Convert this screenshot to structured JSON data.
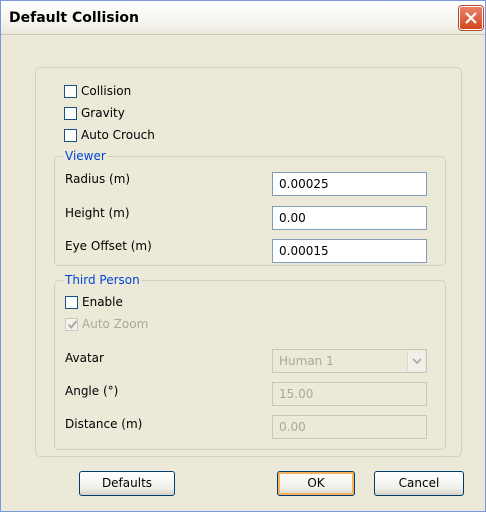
{
  "window": {
    "title": "Default Collision"
  },
  "checkboxes": {
    "collision": {
      "label": "Collision",
      "checked": false
    },
    "gravity": {
      "label": "Gravity",
      "checked": false
    },
    "auto_crouch": {
      "label": "Auto Crouch",
      "checked": false
    }
  },
  "viewer": {
    "legend": "Viewer",
    "radius": {
      "label": "Radius (m)",
      "value": "0.00025"
    },
    "height": {
      "label": "Height (m)",
      "value": "0.00"
    },
    "eye_offset": {
      "label": "Eye Offset (m)",
      "value": "0.00015"
    }
  },
  "third_person": {
    "legend": "Third Person",
    "enable": {
      "label": "Enable",
      "checked": false
    },
    "auto_zoom": {
      "label": "Auto Zoom",
      "checked": true,
      "disabled": true
    },
    "avatar": {
      "label": "Avatar",
      "value": "Human 1"
    },
    "angle": {
      "label": "Angle (°)",
      "value": "15.00"
    },
    "distance": {
      "label": "Distance (m)",
      "value": "0.00"
    }
  },
  "buttons": {
    "defaults": "Defaults",
    "ok": "OK",
    "cancel": "Cancel"
  },
  "colors": {
    "accent": "#0046d5",
    "close": "#d1461f",
    "window_bg": "#ECE9D8"
  }
}
